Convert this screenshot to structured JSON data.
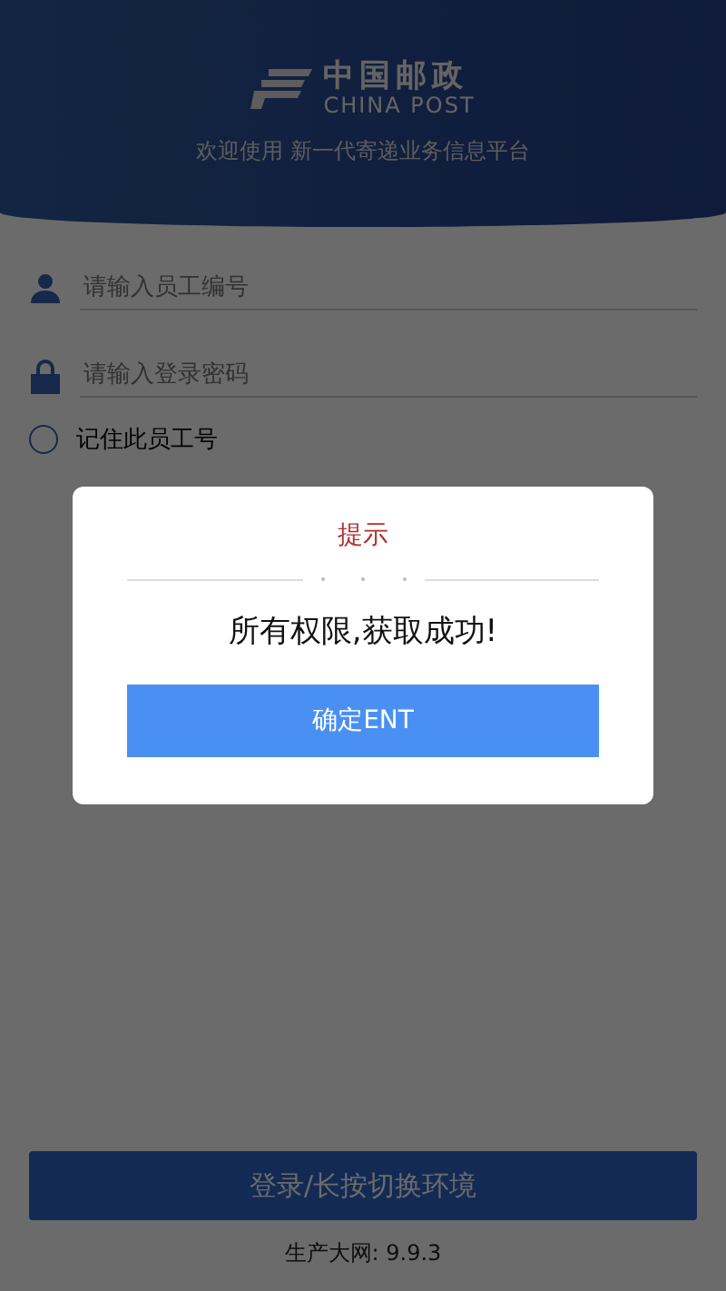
{
  "header": {
    "logo_cn": "中国邮政",
    "logo_en": "CHINA POST",
    "subtitle": "欢迎使用 新一代寄递业务信息平台"
  },
  "fields": [
    {
      "kind": "user",
      "placeholder": "请输入员工编号"
    },
    {
      "kind": "lock",
      "placeholder": "请输入登录密码"
    }
  ],
  "remember": {
    "label": "记住此员工号",
    "checked": false
  },
  "login_button": "登录/长按切换环境",
  "version": "生产大网: 9.9.3",
  "dialog": {
    "title": "提示",
    "message": "所有权限,获取成功!",
    "button": "确定ENT"
  }
}
